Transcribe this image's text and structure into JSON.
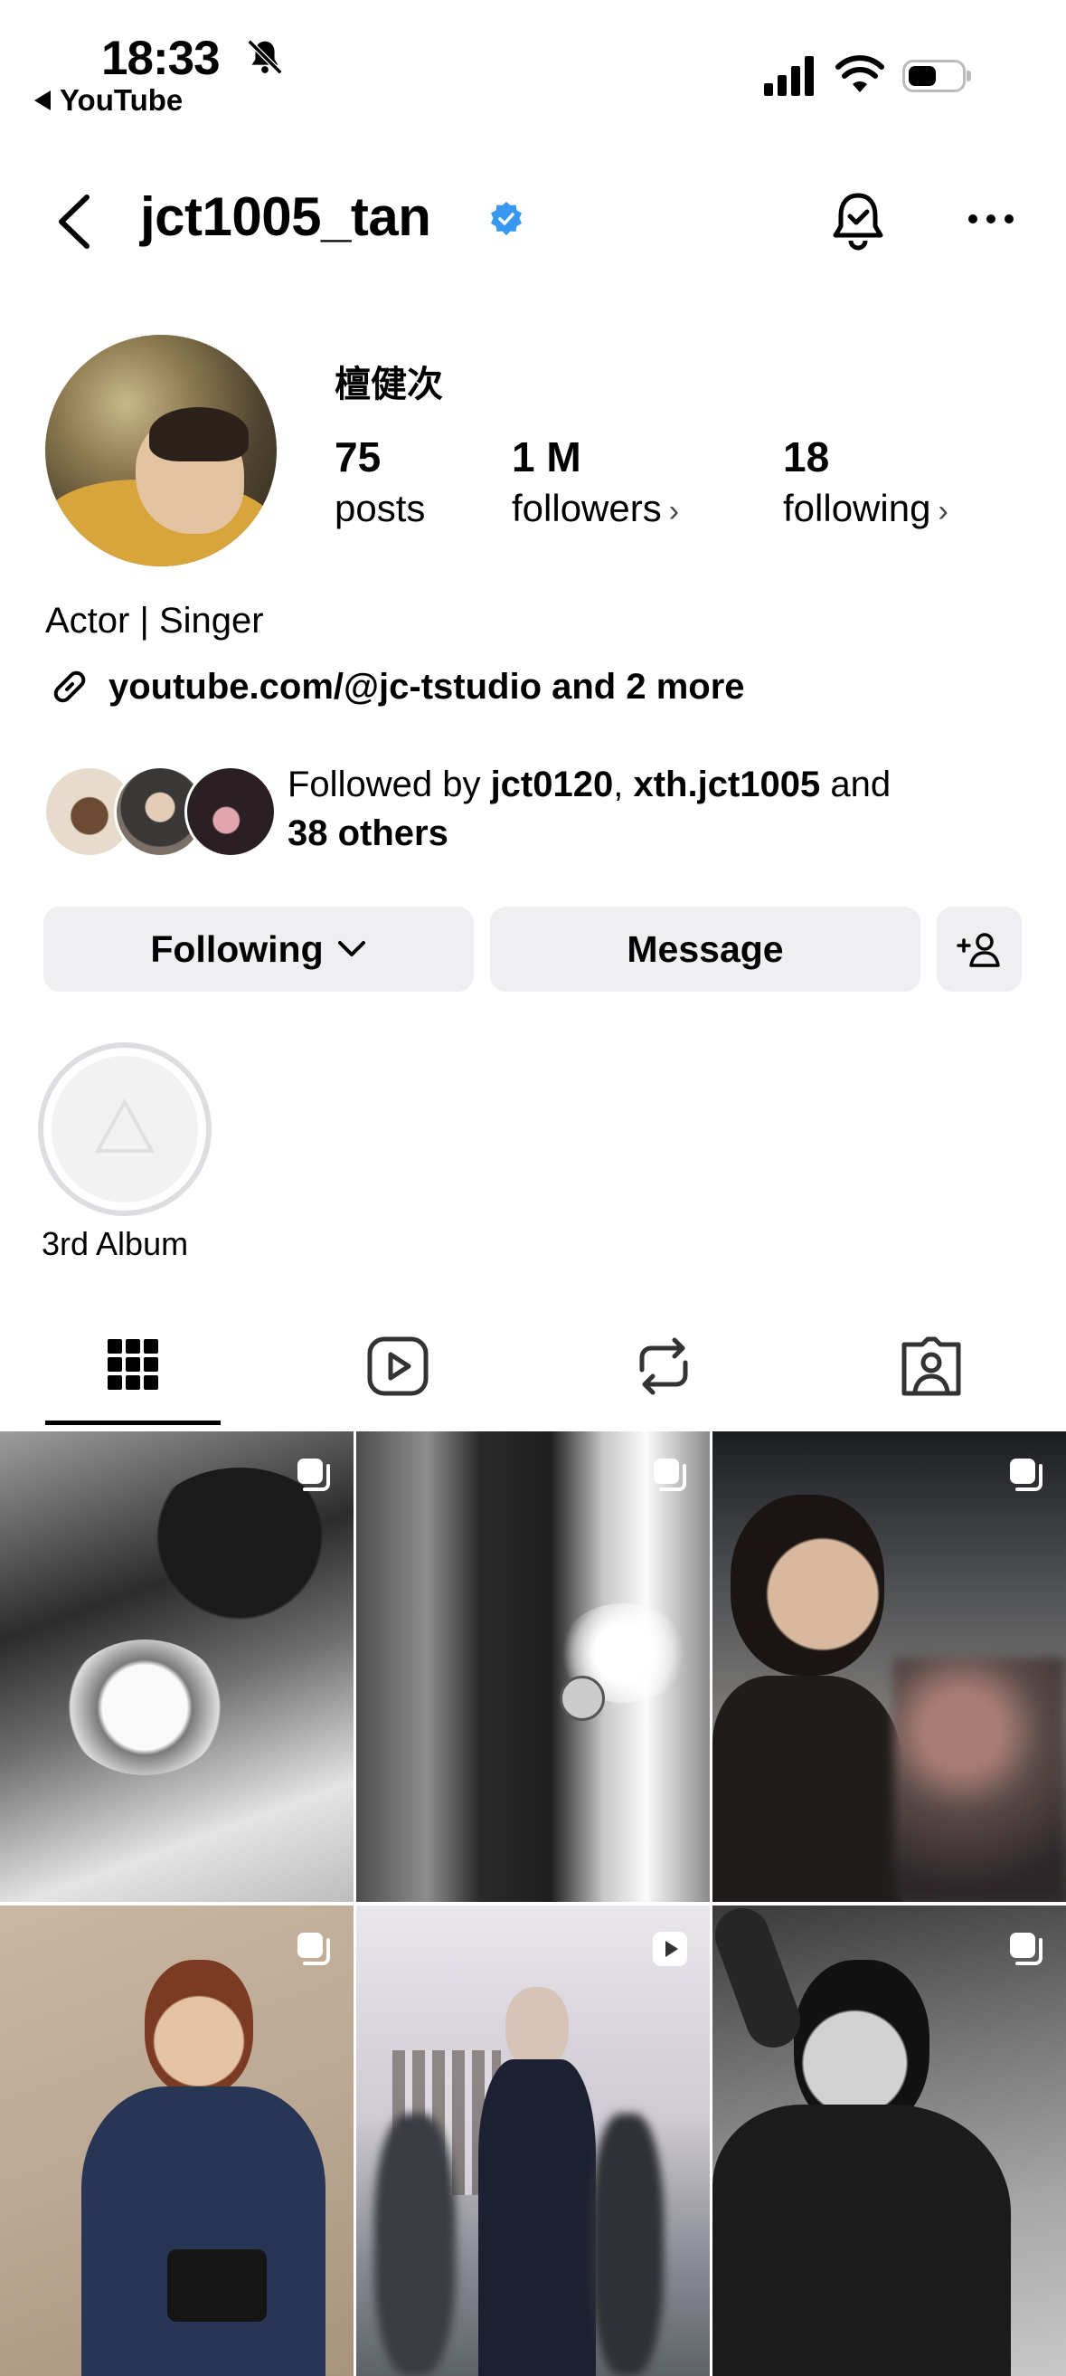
{
  "status_bar": {
    "time": "18:33",
    "back_app": "YouTube"
  },
  "header": {
    "username": "jct1005_tan",
    "verified": true
  },
  "profile": {
    "full_name": "檀健次",
    "stats": [
      {
        "value": "75",
        "label": "posts"
      },
      {
        "value": "1 M",
        "label": "followers"
      },
      {
        "value": "18",
        "label": "following"
      }
    ],
    "bio": "Actor | Singer",
    "link": "youtube.com/@jc-tstudio and 2 more",
    "followed_by_prefix": "Followed by ",
    "followed_by_user1": "jct0120",
    "followed_by_sep": ", ",
    "followed_by_user2": "xth.jct1005",
    "followed_by_and": " and",
    "followed_by_others": "38 others"
  },
  "actions": {
    "following_label": "Following",
    "message_label": "Message"
  },
  "highlights": [
    {
      "label": "3rd Album"
    }
  ],
  "tabs": [
    "posts-grid-icon",
    "reels-icon",
    "reposts-icon",
    "tagged-icon"
  ],
  "grid": [
    {
      "type": "carousel"
    },
    {
      "type": "carousel"
    },
    {
      "type": "carousel"
    },
    {
      "type": "carousel"
    },
    {
      "type": "reel"
    },
    {
      "type": "carousel"
    }
  ],
  "colors": {
    "verified_blue": "#3897f0",
    "button_bg": "#efeff2"
  }
}
